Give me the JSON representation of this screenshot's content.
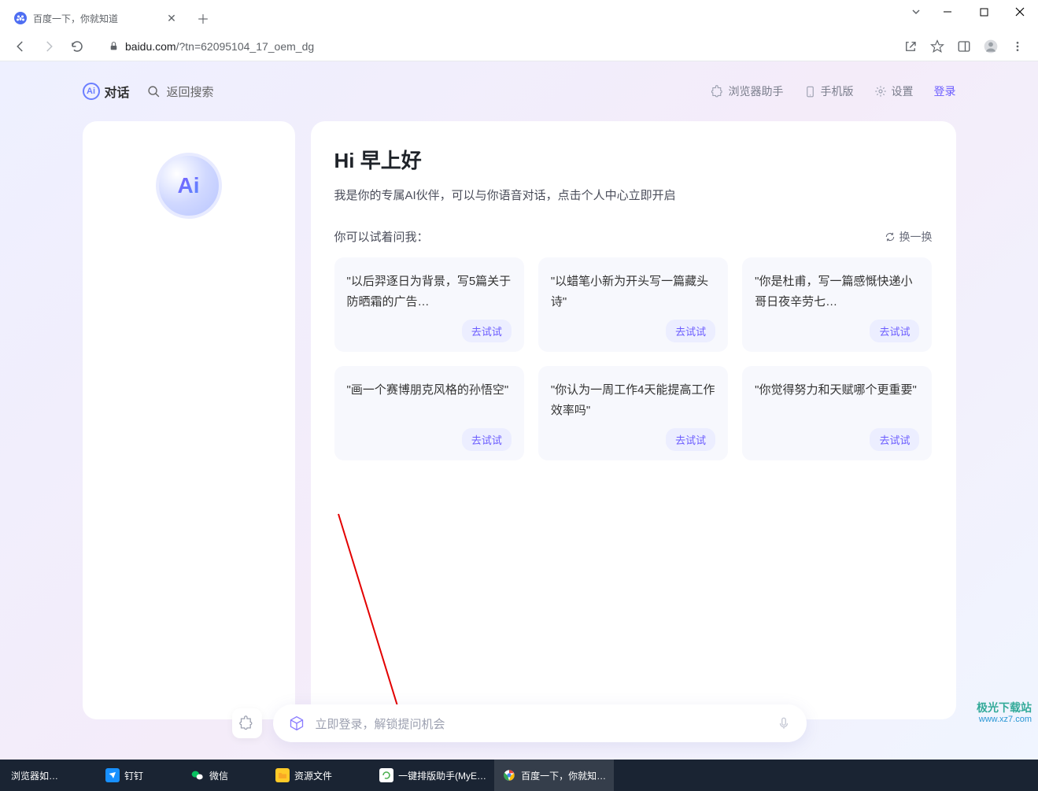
{
  "browser": {
    "tab_title": "百度一下，你就知道",
    "url_host": "baidu.com",
    "url_path": "/?tn=62095104_17_oem_dg"
  },
  "topnav": {
    "chat": "对话",
    "back_search": "返回搜索",
    "helper": "浏览器助手",
    "mobile": "手机版",
    "settings": "设置",
    "login": "登录"
  },
  "ai_orb_text": "Ai",
  "greeting": "Hi 早上好",
  "subtitle": "我是你的专属AI伙伴，可以与你语音对话，点击个人中心立即开启",
  "try_label": "你可以试着问我：",
  "refresh_label": "换一换",
  "prompts": [
    "\"以后羿逐日为背景，写5篇关于防晒霜的广告…",
    "\"以蜡笔小新为开头写一篇藏头诗\"",
    "\"你是杜甫，写一篇感慨快递小哥日夜辛劳七…",
    "\"画一个赛博朋克风格的孙悟空\"",
    "\"你认为一周工作4天能提高工作效率吗\"",
    "\"你觉得努力和天赋哪个更重要\""
  ],
  "try_btn": "去试试",
  "input_placeholder": "立即登录，解锁提问机会",
  "taskbar": {
    "items": [
      "浏览器如…",
      "钉钉",
      "微信",
      "资源文件",
      "一键排版助手(MyE…",
      "百度一下，你就知…"
    ]
  },
  "watermark": {
    "name": "极光下载站",
    "url": "www.xz7.com"
  }
}
